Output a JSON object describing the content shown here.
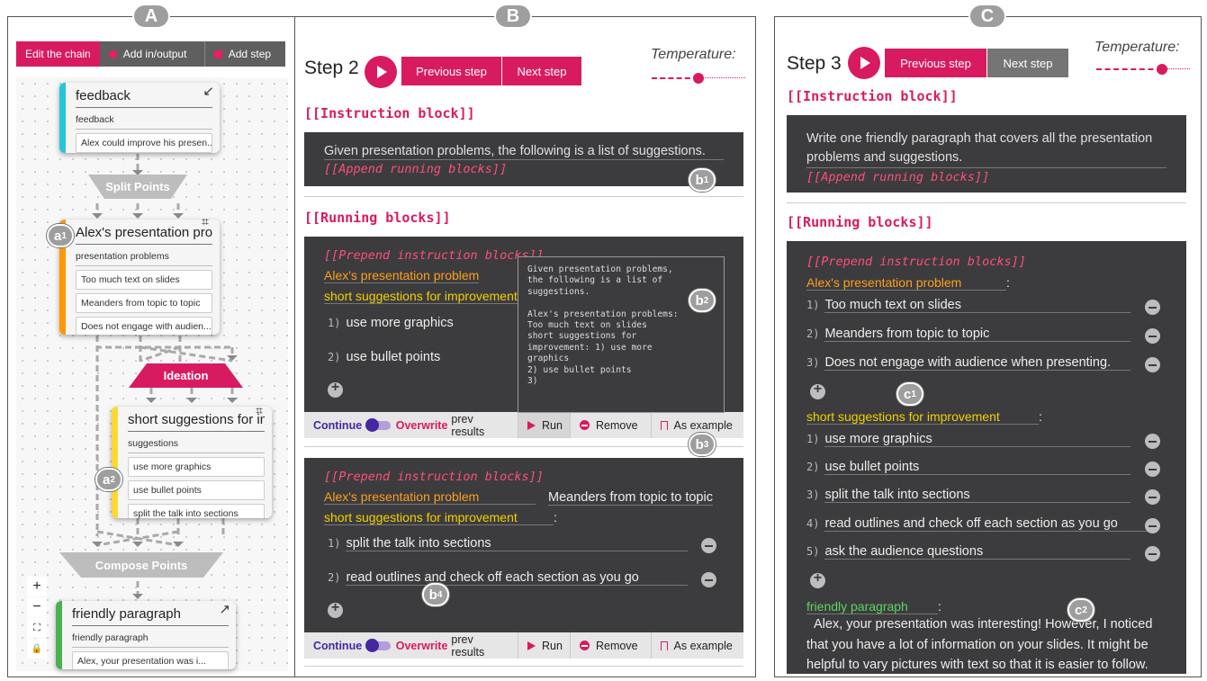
{
  "badges": {
    "a": "A",
    "b": "B",
    "c": "C"
  },
  "marks": {
    "a1": "a",
    "a2": "a",
    "b1": "b",
    "b2": "b",
    "b3": "b",
    "b4": "b",
    "c1": "c",
    "c2": "c"
  },
  "mark_subs": {
    "a1": "1",
    "a2": "2",
    "b1": "1",
    "b2": "2",
    "b3": "3",
    "b4": "4",
    "c1": "1",
    "c2": "2"
  },
  "chain_toolbar": {
    "edit": "Edit the chain",
    "add_io": "Add in/output",
    "add_step": "Add step"
  },
  "nodes": {
    "feedback": {
      "title": "feedback",
      "sub": "feedback",
      "rows": [
        "Alex could improve his presen..."
      ]
    },
    "problems": {
      "title": "Alex's presentation prob",
      "sub": "presentation problems",
      "rows": [
        "Too much text on slides",
        "Meanders from topic to topic",
        "Does not engage with audien..."
      ]
    },
    "suggestions": {
      "title": "short suggestions for im",
      "sub": "suggestions",
      "rows": [
        "use more graphics",
        "use bullet points",
        "split the talk into sections"
      ]
    },
    "friendly": {
      "title": "friendly paragraph",
      "sub": "friendly paragraph",
      "rows": [
        "Alex, your presentation was i..."
      ]
    }
  },
  "ops": {
    "split": "Split Points",
    "ideation": "Ideation",
    "compose": "Compose Points"
  },
  "zoom": {
    "plus": "+",
    "minus": "−",
    "fit": "⛶",
    "lock": "🔒"
  },
  "colors": {
    "accent": "#d81b60",
    "panel": "#3c3c3e",
    "cyan": "#26c6da",
    "orange": "#ff9800",
    "yellow": "#fdd835",
    "green": "#4caf50"
  },
  "b": {
    "step": "Step 2",
    "prev": "Previous step",
    "next": "Next step",
    "temperature": "Temperature:",
    "temperature_level": 0.5,
    "instruction_header": "[[Instruction block]]",
    "instruction_text": "Given presentation problems, the following is a list of suggestions.",
    "append": "[[Append running blocks]]",
    "running_header": "[[Running blocks]]",
    "prepend": "[[Prepend instruction blocks]]",
    "block1": {
      "label1": "Alex's presentation problem",
      "label2": "short suggestions for improvement",
      "items": [
        "use more graphics",
        "use bullet points"
      ]
    },
    "tooltip": "Given presentation problems,\nthe following is a list of\nsuggestions.\n\nAlex's presentation problems:\nToo much text on slides\nshort suggestions for\nimprovement: 1) use more\ngraphics\n2) use bullet points\n3)",
    "block2": {
      "label1": "Alex's presentation problem",
      "value1": "Meanders from topic to topic",
      "label2": "short suggestions for improvement",
      "colon": ":",
      "items": [
        "split the talk into sections",
        "read outlines and check off each section as you go"
      ]
    },
    "toolbar": {
      "continue": "Continue",
      "overwrite": "Overwrite",
      "prev_results": "prev results",
      "run": "Run",
      "remove": "Remove",
      "example": "As example"
    }
  },
  "c": {
    "step": "Step 3",
    "prev": "Previous step",
    "next": "Next step",
    "temperature": "Temperature:",
    "temperature_level": 0.7,
    "instruction_header": "[[Instruction block]]",
    "instruction_text": "Write one friendly paragraph that covers all the presentation problems and suggestions.",
    "append": "[[Append running blocks]]",
    "running_header": "[[Running blocks]]",
    "prepend": "[[Prepend instruction blocks]]",
    "label1": "Alex's presentation problem",
    "colon": ":",
    "problems": [
      "Too much text on slides",
      "Meanders from topic to topic",
      "Does not engage with audience when presenting."
    ],
    "label2": "short suggestions for improvement",
    "suggestions": [
      "use more graphics",
      "use bullet points",
      "split the talk into sections",
      "read outlines and check off each section as you go",
      "ask the audience questions"
    ],
    "label3": "friendly paragraph",
    "paragraph": "Alex, your presentation was interesting! However, I noticed that you have a lot of information on your slides. It might be helpful to vary pictures with text so that it is easier to follow."
  }
}
